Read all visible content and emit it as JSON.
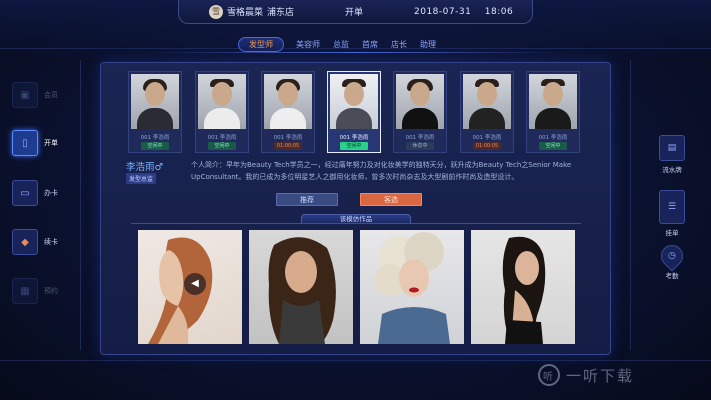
{
  "header": {
    "logo_text": "雪",
    "brand": "雪格晨菜",
    "store": "浦东店",
    "title": "开单",
    "date": "2018-07-31",
    "time": "18:06"
  },
  "tabs": [
    {
      "label": "发型师",
      "active": true
    },
    {
      "label": "美容师"
    },
    {
      "label": "总监"
    },
    {
      "label": "首席"
    },
    {
      "label": "店长"
    },
    {
      "label": "助理"
    }
  ],
  "left_nav": [
    {
      "label": "会员",
      "icon": "member-icon",
      "state": "dim"
    },
    {
      "label": "开单",
      "icon": "order-icon",
      "state": "active"
    },
    {
      "label": "办卡",
      "icon": "card-icon",
      "state": "normal"
    },
    {
      "label": "续卡",
      "icon": "renew-card-icon",
      "state": "normal"
    },
    {
      "label": "预约",
      "icon": "calendar-icon",
      "state": "dim"
    }
  ],
  "right_nav": [
    {
      "label": "流水牌",
      "icon": "badge-icon"
    },
    {
      "label": "挂单",
      "icon": "pending-list-icon"
    },
    {
      "label": "考勤",
      "icon": "location-pin-icon"
    }
  ],
  "staff": [
    {
      "name": "001 李浩雨",
      "status": "空闲中",
      "state": "free",
      "gender": "f"
    },
    {
      "name": "001 李浩雨",
      "status": "空闲中",
      "state": "free",
      "gender": "m"
    },
    {
      "name": "001 李浩雨",
      "status": "01:00:05",
      "state": "busy",
      "gender": "f"
    },
    {
      "name": "001 李浩雨",
      "status": "空闲中",
      "state": "free",
      "gender": "m",
      "selected": true
    },
    {
      "name": "001 李浩雨",
      "status": "休息中",
      "state": "free",
      "gender": "f"
    },
    {
      "name": "001 李浩雨",
      "status": "01:00:05",
      "state": "busy",
      "gender": "m"
    },
    {
      "name": "001 李浩雨",
      "status": "空闲中",
      "state": "free",
      "gender": "m"
    }
  ],
  "profile": {
    "name": "李浩雨♂",
    "tag": "发型总监",
    "intro": "个人简介：早年为Beauty Tech学员之一，经过痛年努力及对化妆美学的独特天分，跃升成为Beauty Tech之Senior Make UpConsultant。我的已成为多位明星艺人之御用化妆师，曾多次时尚杂志及大型剧前作时尚及造型设计。"
  },
  "actions": {
    "recommend": "推荐",
    "choose": "客选"
  },
  "works": {
    "title": "该模仿作品",
    "items": [
      {
        "name": "red-hair-profile"
      },
      {
        "name": "brunette-waves"
      },
      {
        "name": "platinum-curls"
      },
      {
        "name": "black-waves-profile"
      }
    ]
  },
  "watermark": {
    "icon": "听",
    "text": "一听下载"
  }
}
